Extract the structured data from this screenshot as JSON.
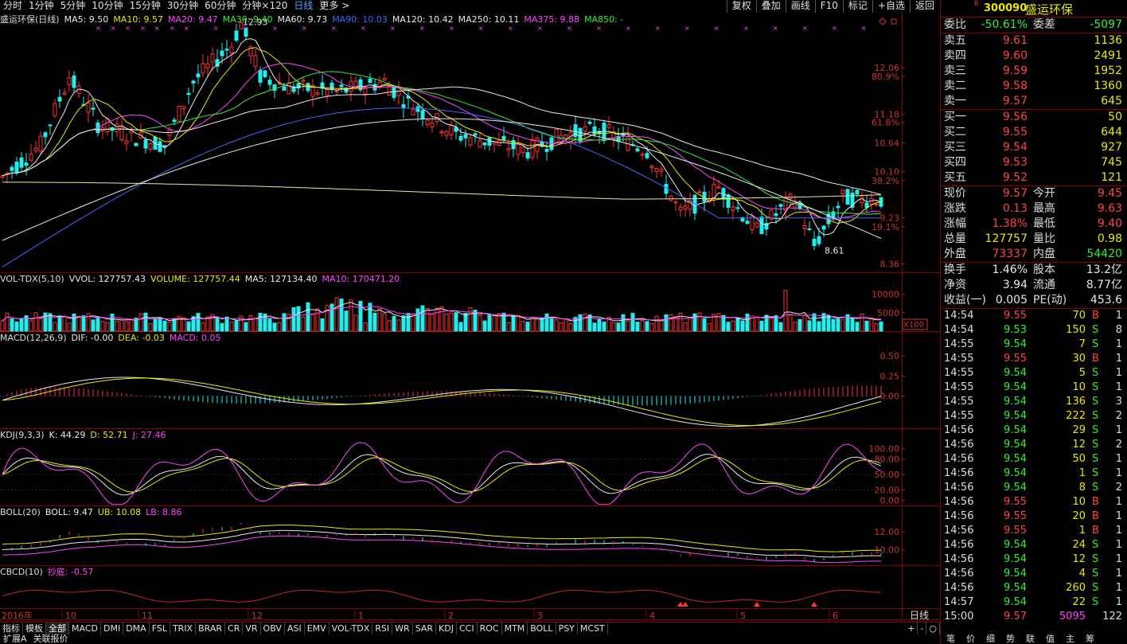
{
  "toolbar": {
    "periods": [
      "分时",
      "1分钟",
      "5分钟",
      "10分钟",
      "15分钟",
      "30分钟",
      "60分钟",
      "分钟×120",
      "日线",
      "更多 >"
    ],
    "active_period": 8,
    "buttons": [
      "复权",
      "叠加",
      "画线",
      "F10",
      "标记",
      "+自选",
      "返回"
    ]
  },
  "main_title": {
    "name": "盛运环保(日线)",
    "items": [
      {
        "label": "MA5: 9.50",
        "color": "#e8e8e8"
      },
      {
        "label": "MA10: 9.57",
        "color": "#e8e800"
      },
      {
        "label": "MA20: 9.47",
        "color": "#ff44ff"
      },
      {
        "label": "MA30: 9.40",
        "color": "#33ee33"
      },
      {
        "label": "MA60: 9.73",
        "color": "#e8e8e8"
      },
      {
        "label": "MA90: 10.03",
        "color": "#4466ff"
      },
      {
        "label": "MA120: 10.42",
        "color": "#e8e8e8"
      },
      {
        "label": "MA250: 10.11",
        "color": "#e8e8e8"
      },
      {
        "label": "MA375: 9.88",
        "color": "#ff44ff"
      },
      {
        "label": "MA850: -",
        "color": "#33ee33"
      }
    ]
  },
  "vol_title": {
    "name": "VOL-TDX(5,10)",
    "items": [
      {
        "label": "VVOL: 127757.43",
        "color": "#e8e8e8"
      },
      {
        "label": "VOLUME: 127757.44",
        "color": "#e8e800"
      },
      {
        "label": "MA5: 127134.40",
        "color": "#e8e8e8"
      },
      {
        "label": "MA10: 170471.20",
        "color": "#ff44ff"
      }
    ]
  },
  "macd_title": {
    "name": "MACD(12,26,9)",
    "items": [
      {
        "label": "DIF: -0.00",
        "color": "#e8e8e8"
      },
      {
        "label": "DEA: -0.03",
        "color": "#e8e800"
      },
      {
        "label": "MACD: 0.05",
        "color": "#ff44ff"
      }
    ]
  },
  "kdj_title": {
    "name": "KDJ(9,3,3)",
    "items": [
      {
        "label": "K: 44.29",
        "color": "#e8e8e8"
      },
      {
        "label": "D: 52.71",
        "color": "#e8e800"
      },
      {
        "label": "J: 27.46",
        "color": "#ff44ff"
      }
    ]
  },
  "boll_title": {
    "name": "BOLL(20)",
    "items": [
      {
        "label": "BOLL: 9.47",
        "color": "#e8e8e8"
      },
      {
        "label": "UB: 10.08",
        "color": "#e8e800"
      },
      {
        "label": "LB: 8.86",
        "color": "#ff44ff"
      }
    ]
  },
  "cbd_title": {
    "name": "CBCD(10)",
    "items": [
      {
        "label": "抄底: -0.57",
        "color": "#ff44ff"
      }
    ]
  },
  "chart_data": {
    "type": "candlestick",
    "price_axis": {
      "ticks": [
        12.06,
        11.18,
        10.64,
        10.1,
        9.23,
        8.36
      ],
      "pct_ticks": [
        {
          "label": "80.9%",
          "value": 11.9
        },
        {
          "label": "61.8%",
          "value": 11.03
        },
        {
          "label": "38.2%",
          "value": 9.93
        },
        {
          "label": "19.1%",
          "value": 9.06
        }
      ],
      "range": [
        8.2,
        13.1
      ]
    },
    "price_annotations": [
      {
        "label": "12.93",
        "value": 12.93
      },
      {
        "label": "8.61",
        "value": 8.61
      }
    ],
    "vol_axis": {
      "ticks": [
        10000,
        5000
      ],
      "unit": "X100",
      "max": 12500
    },
    "macd_axis": {
      "ticks": [
        0.5,
        0.25,
        0.0
      ],
      "range": [
        -0.4,
        0.65
      ]
    },
    "kdj_axis": {
      "ticks": [
        100.0,
        80.0,
        50.0,
        20.0,
        0.0
      ],
      "range": [
        -10,
        115
      ]
    },
    "boll_axis": {
      "ticks": [
        12.0,
        10.0
      ],
      "range": [
        8.3,
        13.5
      ]
    },
    "x_axis": {
      "label_year": "2016年",
      "months": [
        "10",
        "11",
        "12",
        "1",
        "2",
        "3",
        "4",
        "5",
        "6"
      ],
      "end_label": "日线"
    }
  },
  "stock": {
    "code": "300090",
    "name": "盛运环保",
    "mark": "R"
  },
  "quote": {
    "weibi": {
      "label": "委比",
      "value": "-50.61%",
      "label2": "委差",
      "value2": "-5097"
    },
    "asks": [
      {
        "label": "卖五",
        "price": "9.61",
        "vol": "1136"
      },
      {
        "label": "卖四",
        "price": "9.60",
        "vol": "2491"
      },
      {
        "label": "卖三",
        "price": "9.59",
        "vol": "1952"
      },
      {
        "label": "卖二",
        "price": "9.58",
        "vol": "1360"
      },
      {
        "label": "卖一",
        "price": "9.57",
        "vol": "645"
      }
    ],
    "bids": [
      {
        "label": "买一",
        "price": "9.56",
        "vol": "50"
      },
      {
        "label": "买二",
        "price": "9.55",
        "vol": "644"
      },
      {
        "label": "买三",
        "price": "9.54",
        "vol": "927"
      },
      {
        "label": "买四",
        "price": "9.53",
        "vol": "745"
      },
      {
        "label": "买五",
        "price": "9.52",
        "vol": "121"
      }
    ],
    "stats1": [
      {
        "l1": "现价",
        "v1": "9.57",
        "c1": "red",
        "l2": "今开",
        "v2": "9.45",
        "c2": "red"
      },
      {
        "l1": "涨跌",
        "v1": "0.13",
        "c1": "red",
        "l2": "最高",
        "v2": "9.63",
        "c2": "red"
      },
      {
        "l1": "涨幅",
        "v1": "1.38%",
        "c1": "red",
        "l2": "最低",
        "v2": "9.40",
        "c2": "red"
      },
      {
        "l1": "总量",
        "v1": "127757",
        "c1": "yellow",
        "l2": "量比",
        "v2": "0.98",
        "c2": "yellow"
      },
      {
        "l1": "外盘",
        "v1": "73337",
        "c1": "red",
        "l2": "内盘",
        "v2": "54420",
        "c2": "green"
      }
    ],
    "stats2": [
      {
        "l1": "换手",
        "v1": "1.46%",
        "c1": "white",
        "l2": "股本",
        "v2": "13.2亿",
        "c2": "white"
      },
      {
        "l1": "净资",
        "v1": "3.94",
        "c1": "white",
        "l2": "流通",
        "v2": "8.77亿",
        "c2": "white"
      },
      {
        "l1": "收益(一)",
        "v1": "0.005",
        "c1": "white",
        "l2": "PE(动)",
        "v2": "453.6",
        "c2": "white"
      }
    ]
  },
  "ticks": [
    {
      "t": "14:54",
      "p": "9.55",
      "q": "70",
      "s": "B",
      "n": "1"
    },
    {
      "t": "14:54",
      "p": "9.53",
      "q": "150",
      "s": "S",
      "n": "8"
    },
    {
      "t": "14:55",
      "p": "9.54",
      "q": "7",
      "s": "S",
      "n": "1"
    },
    {
      "t": "14:55",
      "p": "9.55",
      "q": "30",
      "s": "B",
      "n": "1"
    },
    {
      "t": "14:55",
      "p": "9.54",
      "q": "5",
      "s": "S",
      "n": "1"
    },
    {
      "t": "14:55",
      "p": "9.54",
      "q": "10",
      "s": "S",
      "n": "1"
    },
    {
      "t": "14:55",
      "p": "9.54",
      "q": "136",
      "s": "S",
      "n": "3"
    },
    {
      "t": "14:55",
      "p": "9.54",
      "q": "222",
      "s": "S",
      "n": "2"
    },
    {
      "t": "14:56",
      "p": "9.54",
      "q": "29",
      "s": "S",
      "n": "1"
    },
    {
      "t": "14:56",
      "p": "9.54",
      "q": "12",
      "s": "S",
      "n": "2"
    },
    {
      "t": "14:56",
      "p": "9.54",
      "q": "50",
      "s": "S",
      "n": "1"
    },
    {
      "t": "14:56",
      "p": "9.54",
      "q": "1",
      "s": "S",
      "n": "1"
    },
    {
      "t": "14:56",
      "p": "9.54",
      "q": "8",
      "s": "S",
      "n": "2"
    },
    {
      "t": "14:56",
      "p": "9.55",
      "q": "10",
      "s": "B",
      "n": "1"
    },
    {
      "t": "14:56",
      "p": "9.55",
      "q": "20",
      "s": "B",
      "n": "1"
    },
    {
      "t": "14:56",
      "p": "9.55",
      "q": "1",
      "s": "B",
      "n": "1"
    },
    {
      "t": "14:56",
      "p": "9.54",
      "q": "24",
      "s": "S",
      "n": "1"
    },
    {
      "t": "14:56",
      "p": "9.54",
      "q": "12",
      "s": "S",
      "n": "1"
    },
    {
      "t": "14:56",
      "p": "9.54",
      "q": "4",
      "s": "S",
      "n": "1"
    },
    {
      "t": "14:56",
      "p": "9.54",
      "q": "260",
      "s": "S",
      "n": "1"
    },
    {
      "t": "14:57",
      "p": "9.54",
      "q": "22",
      "s": "S",
      "n": "1"
    },
    {
      "t": "15:00",
      "p": "9.57",
      "q": "5095",
      "s": "",
      "n": "122"
    }
  ],
  "bottom_tabs": [
    "指标",
    "模板",
    "全部",
    "MACD",
    "DMI",
    "DMA",
    "FSL",
    "TRIX",
    "BRAR",
    "CR",
    "VR",
    "OBV",
    "ASI",
    "EMV",
    "VOL-TDX",
    "RSI",
    "WR",
    "SAR",
    "KDJ",
    "CCI",
    "ROC",
    "MTM",
    "BOLL",
    "PSY",
    "MCST"
  ],
  "active_tab": 2,
  "tab_controls": [
    "+",
    "-",
    "○"
  ],
  "bottom_row2": [
    "扩展A",
    "关联报价"
  ],
  "right_foot": [
    "笔",
    "价",
    "细",
    "势",
    "联",
    "值",
    "主",
    "筹"
  ],
  "colors": {
    "up": "#ff3333",
    "down": "#22eeee",
    "frame": "#880000"
  }
}
